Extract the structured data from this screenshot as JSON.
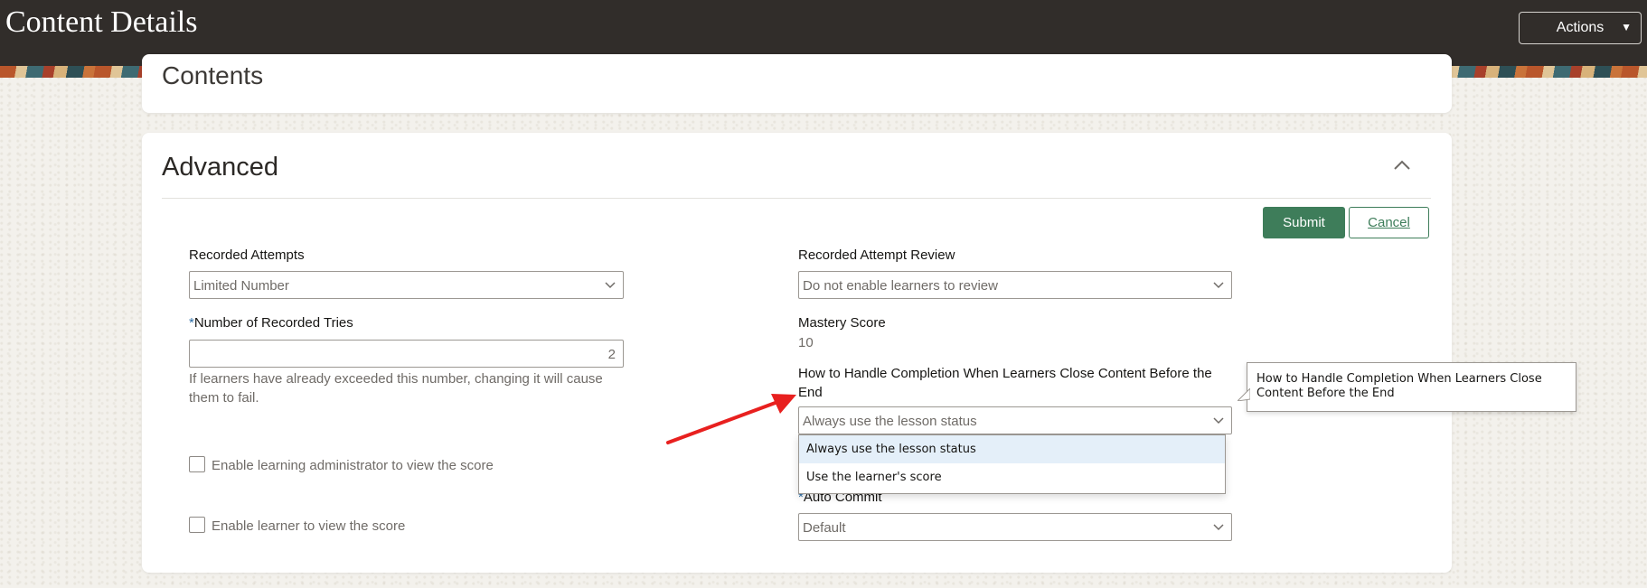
{
  "header": {
    "title": "Content Details",
    "actions_label": "Actions"
  },
  "contents_section": {
    "title": "Contents"
  },
  "advanced": {
    "title": "Advanced",
    "submit_label": "Submit",
    "cancel_label": "Cancel",
    "recorded_attempts": {
      "label": "Recorded Attempts",
      "value": "Limited Number"
    },
    "number_of_tries": {
      "required_mark": "*",
      "label": "Number of Recorded Tries",
      "value": "2",
      "help": "If learners have already exceeded this number, changing it will cause them to fail."
    },
    "enable_admin_view": {
      "label": "Enable learning administrator to view the score",
      "checked": false
    },
    "enable_learner_view": {
      "label": "Enable learner to view the score",
      "checked": false
    },
    "recorded_attempt_review": {
      "label": "Recorded Attempt Review",
      "value": "Do not enable learners to review"
    },
    "mastery_score": {
      "label": "Mastery Score",
      "value": "10"
    },
    "handle_completion": {
      "label": "How to Handle Completion When Learners Close Content Before the End",
      "value": "Always use the lesson status",
      "options": [
        "Always use the lesson status",
        "Use the learner's score"
      ],
      "tooltip": "How to Handle Completion When Learners Close Content Before the End"
    },
    "auto_commit": {
      "required_mark": "*",
      "label": "Auto Commit",
      "value": "Default"
    }
  },
  "colors": {
    "header_bg": "#312d2a",
    "submit_green": "#3e7d5a",
    "required_blue": "#2e6ea5",
    "annotation_red": "#e8201f",
    "selected_option_bg": "#e4eff9"
  }
}
